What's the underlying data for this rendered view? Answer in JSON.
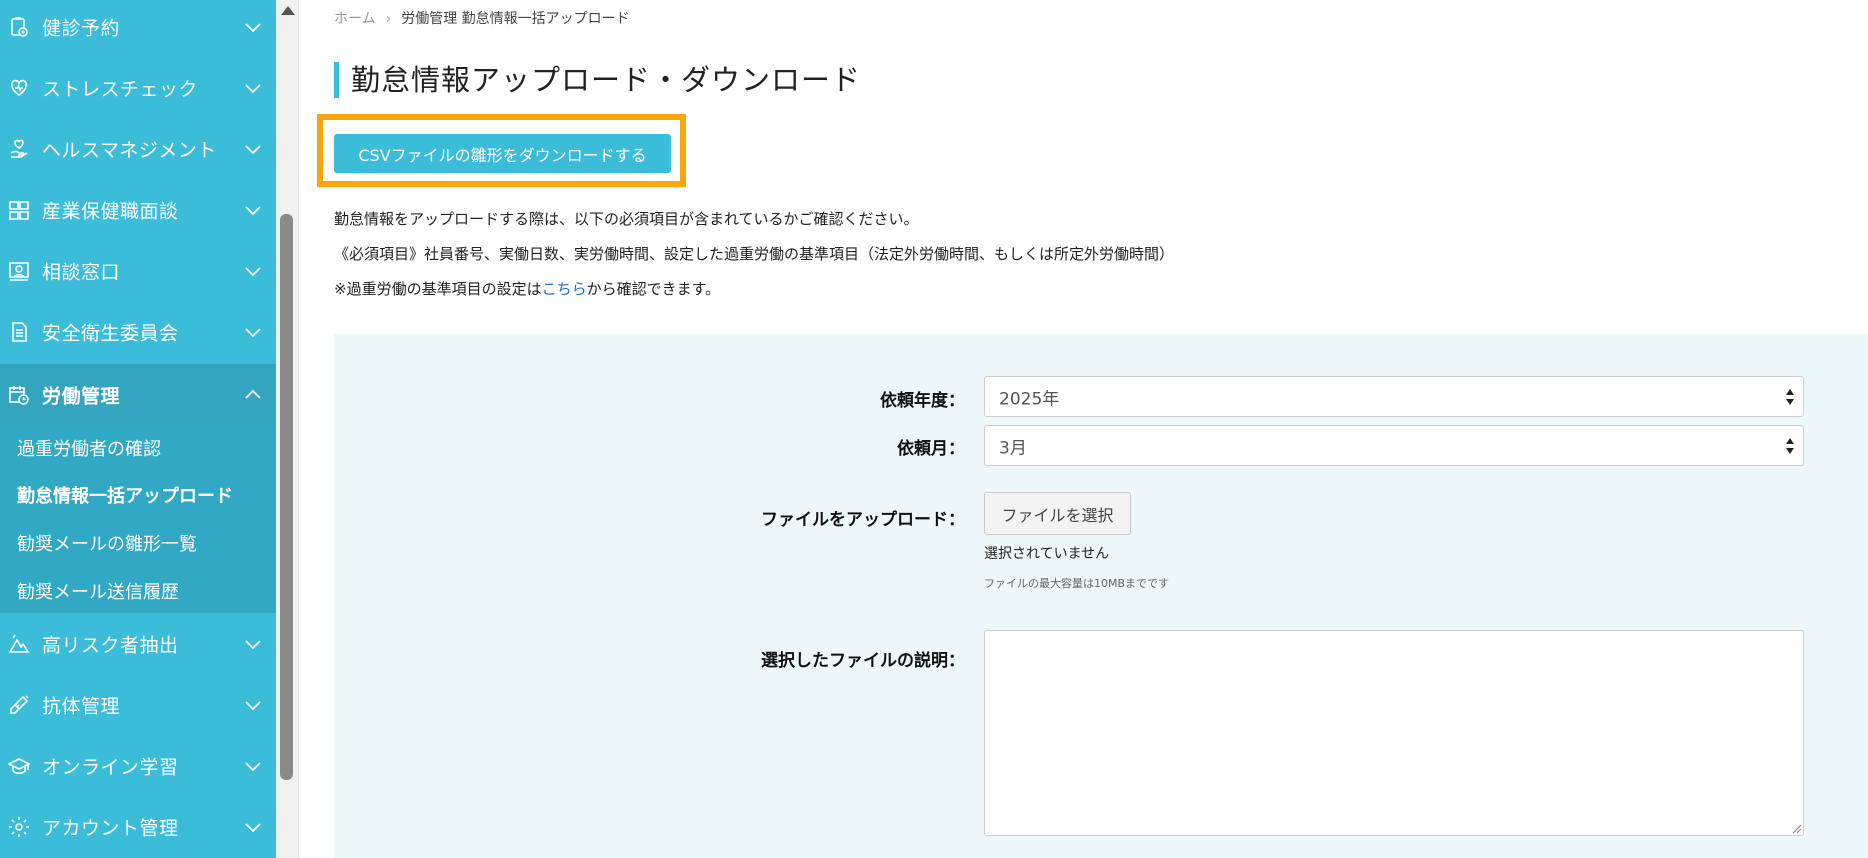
{
  "sidebar": {
    "items": [
      {
        "label": "健診予約",
        "icon": "clipboard-icon"
      },
      {
        "label": "ストレスチェック",
        "icon": "heart-icon"
      },
      {
        "label": "ヘルスマネジメント",
        "icon": "hand-heart-icon"
      },
      {
        "label": "産業保健職面談",
        "icon": "people-icon"
      },
      {
        "label": "相談窓口",
        "icon": "person-board-icon"
      },
      {
        "label": "安全衛生委員会",
        "icon": "document-icon"
      },
      {
        "label": "労働管理",
        "icon": "calendar-clock-icon"
      },
      {
        "label": "高リスク者抽出",
        "icon": "mountain-icon"
      },
      {
        "label": "抗体管理",
        "icon": "syringe-icon"
      },
      {
        "label": "オンライン学習",
        "icon": "graduation-cap-icon"
      },
      {
        "label": "アカウント管理",
        "icon": "gear-icon"
      }
    ],
    "subitems": [
      {
        "label": "過重労働者の確認"
      },
      {
        "label": "勤怠情報一括アップロード"
      },
      {
        "label": "勧奨メールの雛形一覧"
      },
      {
        "label": "勧奨メール送信履歴"
      }
    ]
  },
  "breadcrumb": {
    "home": "ホーム",
    "current": "労働管理 勤怠情報一括アップロード"
  },
  "page": {
    "title": "勤怠情報アップロード・ダウンロード",
    "csv_button": "CSVファイルの雛形をダウンロードする",
    "info_line1": "勤怠情報をアップロードする際は、以下の必須項目が含まれているかご確認ください。",
    "info_line2": "《必須項目》社員番号、実働日数、実労働時間、設定した過重労働の基準項目（法定外労働時間、もしくは所定外労働時間）",
    "info_line3_prefix": "※過重労働の基準項目の設定は",
    "info_line3_link": "こちら",
    "info_line3_suffix": "から確認できます。"
  },
  "form": {
    "year_label": "依頼年度：",
    "year_value": "2025年",
    "month_label": "依頼月：",
    "month_value": "3月",
    "upload_label": "ファイルをアップロード：",
    "file_button": "ファイルを選択",
    "file_status": "選択されていません",
    "file_note": "ファイルの最大容量は10MBまでです",
    "desc_label": "選択したファイルの説明："
  },
  "colors": {
    "sidebar": "#3bbcd9",
    "active_item": "#34a5bf",
    "highlight": "#f7a70d",
    "panel": "#eef8fa",
    "link": "#1a73c7"
  }
}
